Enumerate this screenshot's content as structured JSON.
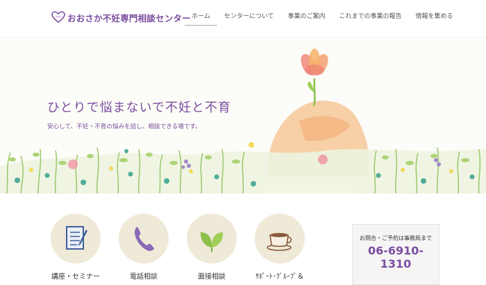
{
  "header": {
    "logo_text": "おおさか不妊専門相談センター",
    "nav": [
      {
        "label": "ホーム",
        "active": true
      },
      {
        "label": "センターについて",
        "active": false
      },
      {
        "label": "事業のご案内",
        "active": false
      },
      {
        "label": "これまでの事業の報告",
        "active": false
      },
      {
        "label": "情報を集める",
        "active": false
      }
    ]
  },
  "hero": {
    "title": "ひとりで悩まないで不妊と不育",
    "subtitle": "安心して、不妊・不育の悩みを話し、相談できる場です。"
  },
  "services": [
    {
      "label": "講座・セミナー",
      "icon": "notebook-icon"
    },
    {
      "label": "電話相談",
      "icon": "phone-icon"
    },
    {
      "label": "面接相談",
      "icon": "leaf-icon"
    },
    {
      "label": "ｻﾎﾟｰﾄ･ｸﾞﾙｰﾌﾟ＆",
      "icon": "coffee-cup-icon"
    }
  ],
  "contact": {
    "note": "お問合・ご予約は事務局まで",
    "phone": "06-6910-1310"
  },
  "colors": {
    "brand": "#7b4e9f",
    "service_circle": "#efe9d8"
  }
}
